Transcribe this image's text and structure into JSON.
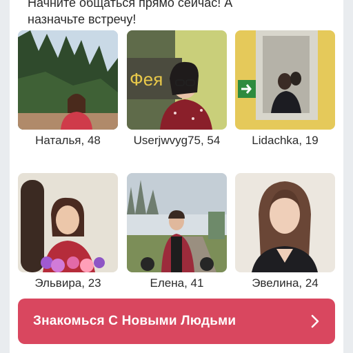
{
  "intro": {
    "line1": "Начните общаться прямо сейчас! А",
    "line2": "назначьте встречу!"
  },
  "profiles": [
    {
      "name": "Наталья, 48"
    },
    {
      "name": "Userjwvyg75, 54"
    },
    {
      "name": "Lidachka, 19"
    },
    {
      "name": "Эльвира, 23"
    },
    {
      "name": "Елена, 41"
    },
    {
      "name": "Эвелина, 24"
    }
  ],
  "cta": {
    "label": "Знакомься С Новыми Людьми",
    "icon": "chevron-right-icon"
  },
  "colors": {
    "accent": "#d9475f",
    "background": "#e9ecef",
    "card": "#ffffff",
    "text": "#2b2b2b"
  }
}
